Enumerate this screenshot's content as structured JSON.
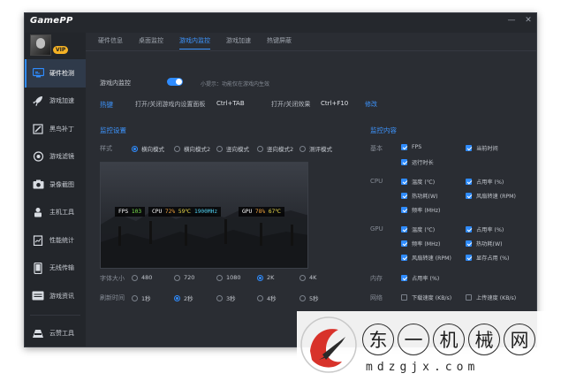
{
  "app": {
    "title": "GamePP",
    "window_buttons": [
      "—",
      "✕"
    ]
  },
  "profile": {
    "badge": "VIP"
  },
  "sidebar": {
    "items": [
      {
        "label": "硬件检测",
        "icon": "monitor-icon",
        "active": true
      },
      {
        "label": "游戏加速",
        "icon": "rocket-icon"
      },
      {
        "label": "黑鸟补丁",
        "icon": "patch-icon"
      },
      {
        "label": "游戏滤镜",
        "icon": "filter-icon"
      },
      {
        "label": "录像截图",
        "icon": "camera-icon"
      },
      {
        "label": "主机工具",
        "icon": "tools-icon"
      },
      {
        "label": "性能统计",
        "icon": "stats-icon"
      },
      {
        "label": "无线传输",
        "icon": "phone-icon"
      },
      {
        "label": "游戏资讯",
        "icon": "news-icon"
      }
    ],
    "bottom_item": {
      "label": "云赞工具",
      "icon": "cloud-tool-icon"
    }
  },
  "tabs": [
    {
      "label": "硬件信息"
    },
    {
      "label": "桌面监控"
    },
    {
      "label": "游戏内监控",
      "active": true
    },
    {
      "label": "游戏加速"
    },
    {
      "label": "热键屏蔽"
    }
  ],
  "monitor": {
    "label": "游戏内监控",
    "enabled": true,
    "tip": "小提示：功能仅在游戏内生效",
    "hotkey_label": "热键",
    "toggle_panel_label": "打开/关闭游戏内设置面板",
    "toggle_panel_key": "Ctrl+TAB",
    "toggle_effect_label": "打开/关闭效果",
    "toggle_effect_key": "Ctrl+F10",
    "modify": "修改"
  },
  "settings": {
    "title": "监控设置",
    "style_label": "样式",
    "styles": [
      {
        "label": "横向模式",
        "selected": true
      },
      {
        "label": "横向模式2"
      },
      {
        "label": "竖向模式"
      },
      {
        "label": "竖向模式2"
      },
      {
        "label": "测评模式"
      }
    ],
    "font_label": "字体大小",
    "fonts": [
      {
        "label": "480"
      },
      {
        "label": "720"
      },
      {
        "label": "1080"
      },
      {
        "label": "2K",
        "selected": true
      },
      {
        "label": "4K"
      }
    ],
    "refresh_label": "刷新时间",
    "refresh": [
      {
        "label": "1秒"
      },
      {
        "label": "2秒",
        "selected": true
      },
      {
        "label": "3秒"
      },
      {
        "label": "4秒"
      },
      {
        "label": "5秒"
      }
    ]
  },
  "overlay": {
    "fps_label": "FPS",
    "fps": "103",
    "cpu_label": "CPU",
    "cpu_usage": "72%",
    "cpu_temp": "59℃",
    "cpu_freq": "1900MHz",
    "gpu_label": "GPU",
    "gpu_usage": "78%",
    "gpu_temp": "67℃"
  },
  "content": {
    "title": "监控内容",
    "groups": [
      {
        "label": "基本",
        "items": [
          {
            "label": "FPS",
            "checked": true
          },
          {
            "label": "当前时间",
            "checked": true
          },
          {
            "label": "运行时长",
            "checked": true
          }
        ]
      },
      {
        "label": "CPU",
        "items": [
          {
            "label": "温度 (℃)",
            "checked": true
          },
          {
            "label": "占用率 (%)",
            "checked": true
          },
          {
            "label": "热功耗(W)",
            "checked": true
          },
          {
            "label": "风扇转速 (RPM)",
            "checked": true
          },
          {
            "label": "频率 (MHz)",
            "checked": true
          }
        ]
      },
      {
        "label": "GPU",
        "items": [
          {
            "label": "温度 (℃)",
            "checked": true
          },
          {
            "label": "占用率 (%)",
            "checked": true
          },
          {
            "label": "频率 (MHz)",
            "checked": true
          },
          {
            "label": "热功耗(W)",
            "checked": true
          },
          {
            "label": "风扇转速 (RPM)",
            "checked": true
          },
          {
            "label": "显存占用 (%)",
            "checked": true
          }
        ]
      },
      {
        "label": "内存",
        "items": [
          {
            "label": "占用率 (%)",
            "checked": true
          }
        ]
      },
      {
        "label": "网络",
        "items": [
          {
            "label": "下载速度 (KB/s)",
            "checked": false
          },
          {
            "label": "上传速度 (KB/s)",
            "checked": false
          }
        ]
      }
    ]
  },
  "watermark": {
    "chars": [
      "东",
      "一",
      "机",
      "械",
      "网"
    ],
    "url": "mdzgjx.com"
  },
  "colors": {
    "accent": "#2f8cff",
    "background": "#2a2d33",
    "sidebar": "#23262b"
  }
}
